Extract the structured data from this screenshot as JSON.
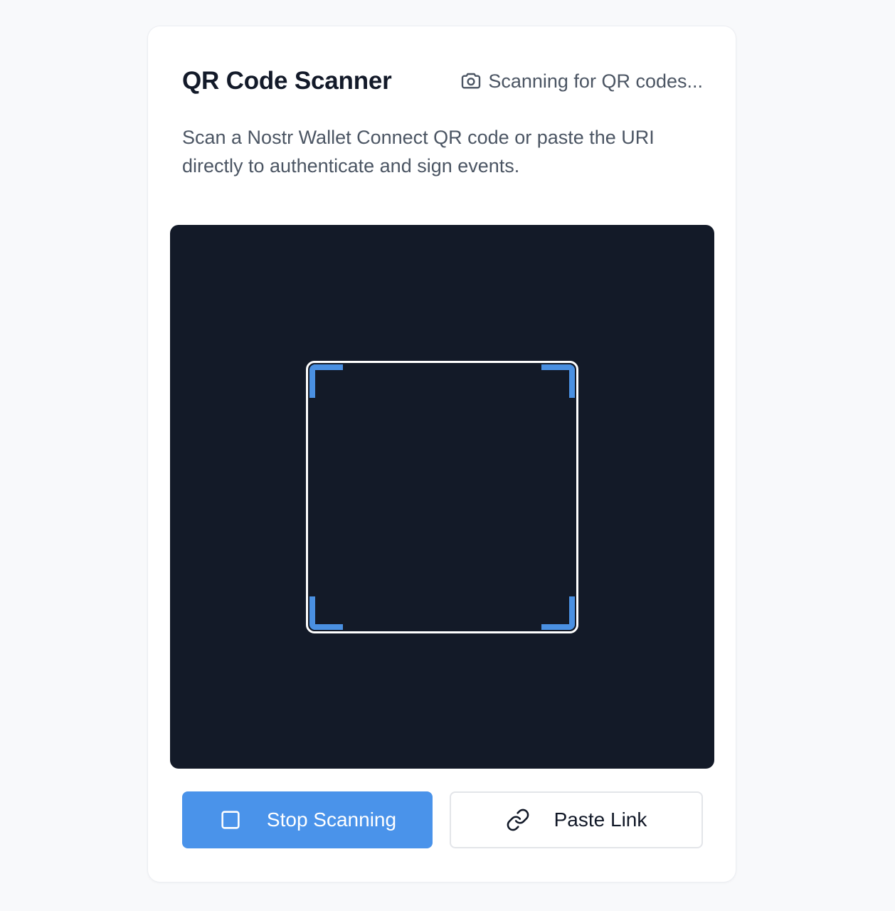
{
  "header": {
    "title": "QR Code Scanner",
    "status_icon": "camera-icon",
    "status_text": "Scanning for QR codes..."
  },
  "description": "Scan a Nostr Wallet Connect QR code or paste the URI directly to authenticate and sign events.",
  "scanner": {
    "background_color": "#131a28",
    "frame_color": "#ffffff",
    "corner_color": "#4a90e2"
  },
  "actions": {
    "stop_button": {
      "icon": "stop-square-icon",
      "label": "Stop Scanning",
      "color": "#4a93ea"
    },
    "paste_button": {
      "icon": "link-icon",
      "label": "Paste Link"
    }
  }
}
